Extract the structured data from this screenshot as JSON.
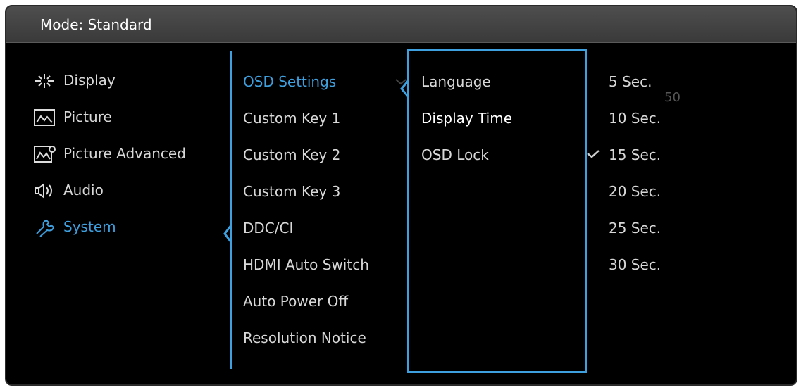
{
  "header": {
    "title": "Mode: Standard"
  },
  "menu": [
    {
      "label": "Display",
      "icon": "display-icon"
    },
    {
      "label": "Picture",
      "icon": "picture-icon"
    },
    {
      "label": "Picture Advanced",
      "icon": "picture-advanced-icon"
    },
    {
      "label": "Audio",
      "icon": "speaker-icon"
    },
    {
      "label": "System",
      "icon": "wrench-icon",
      "selected": true
    }
  ],
  "system_items": [
    "OSD Settings",
    "Custom Key 1",
    "Custom Key 2",
    "Custom Key 3",
    "DDC/CI",
    "HDMI Auto Switch",
    "Auto Power Off",
    "Resolution Notice"
  ],
  "osd_items": [
    "Language",
    "Display Time",
    "OSD Lock"
  ],
  "time_options": [
    "5 Sec.",
    "10 Sec.",
    "15 Sec.",
    "20 Sec.",
    "25 Sec.",
    "30 Sec."
  ],
  "selected_time": "15 Sec.",
  "ghost_value": "50",
  "colors": {
    "accent": "#3fa0df",
    "highlight": "#3d93c8",
    "background": "#000000"
  }
}
